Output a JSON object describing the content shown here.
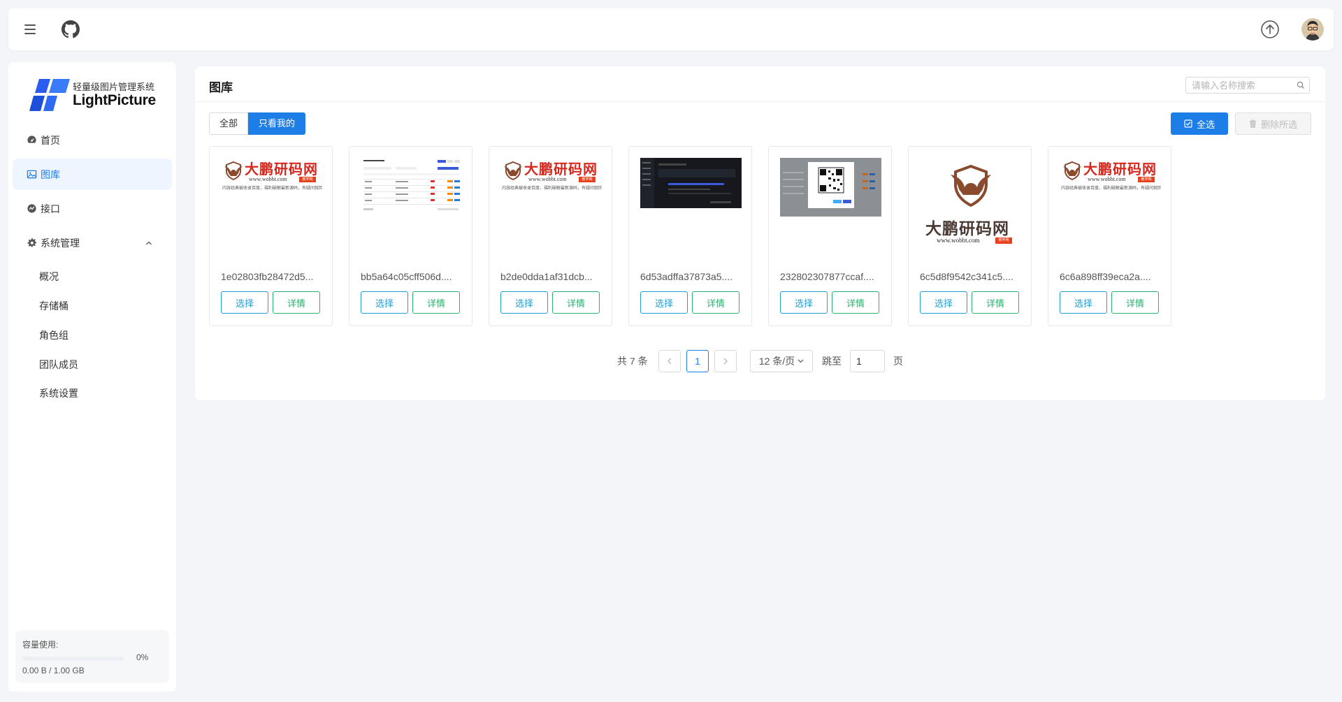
{
  "sidebar": {
    "logo": {
      "tagline": "轻量级图片管理系统",
      "name": "LightPicture"
    },
    "nav": [
      {
        "label": "首页",
        "icon": "dashboard-icon"
      },
      {
        "label": "图库",
        "icon": "image-icon",
        "active": true
      },
      {
        "label": "接口",
        "icon": "api-icon"
      },
      {
        "label": "系统管理",
        "icon": "gear-icon",
        "expanded": true
      }
    ],
    "sub_items": [
      "概况",
      "存储桶",
      "角色组",
      "团队成员",
      "系统设置"
    ],
    "storage": {
      "label": "容量使用:",
      "percent_text": "0%",
      "percent": 0,
      "size": "0.00 B / 1.00 GB"
    }
  },
  "panel": {
    "title": "图库",
    "search_placeholder": "请输入名称搜索",
    "filter": {
      "all": "全部",
      "mine": "只看我的"
    },
    "select_all": "全选",
    "delete_selected": "删除所选",
    "cards": [
      {
        "name": "1e02803fb28472d5...",
        "thumb": "brand"
      },
      {
        "name": "bb5a64c05cff506d....",
        "thumb": "table-screenshot"
      },
      {
        "name": "b2de0dda1af31dcb...",
        "thumb": "brand"
      },
      {
        "name": "6d53adffa37873a5....",
        "thumb": "dark-screenshot"
      },
      {
        "name": "232802307877ccaf....",
        "thumb": "qr-screenshot"
      },
      {
        "name": "6c5d8f9542c341c5....",
        "thumb": "big-brand"
      },
      {
        "name": "6c6a898ff39eca2a....",
        "thumb": "brand"
      }
    ],
    "card_select": "选择",
    "card_detail": "详情",
    "brand": {
      "text": "大鹏研码网",
      "url": "www.wobbt.com",
      "tag": "教学网",
      "slogan": "内容经典被收录百度，福利破解最新源码，有疑问就回复，不见不散～"
    }
  },
  "pagination": {
    "total": "共 7 条",
    "current_page": "1",
    "page_size": "12 条/页",
    "jump_label": "跳至",
    "jump_value": "1",
    "page_unit": "页"
  }
}
